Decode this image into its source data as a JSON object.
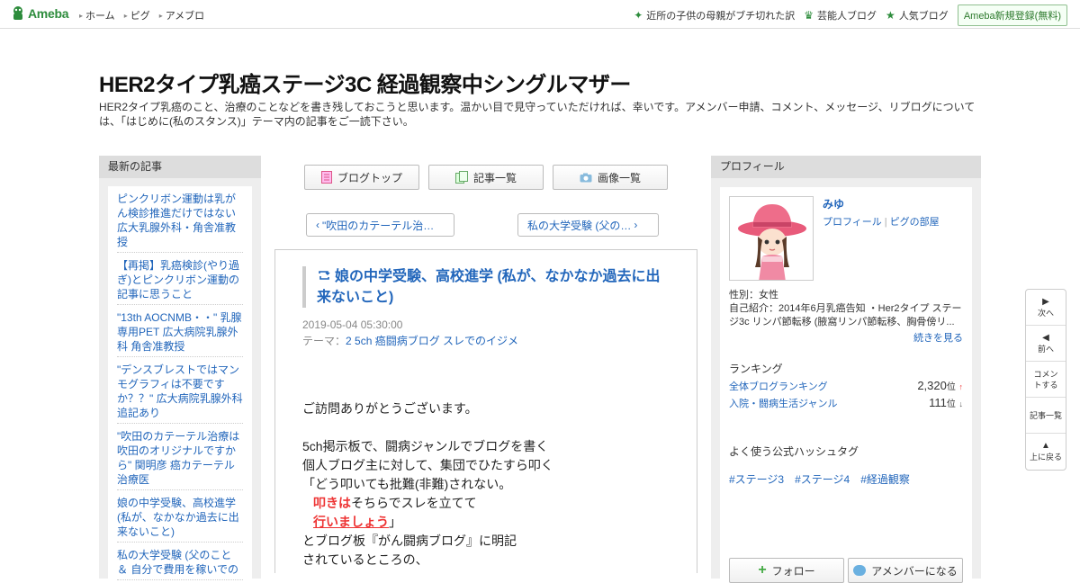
{
  "topbar": {
    "logo": "Ameba",
    "nav": [
      "ホーム",
      "ピグ",
      "アメブロ"
    ],
    "right_links": [
      {
        "icon": "sparkle-icon",
        "label": "近所の子供の母親がブチ切れた訳"
      },
      {
        "icon": "crown-icon",
        "label": "芸能人ブログ"
      },
      {
        "icon": "star-icon",
        "label": "人気ブログ"
      }
    ],
    "register": "Ameba新規登録(無料)"
  },
  "header": {
    "title": "HER2タイプ乳癌ステージ3C 経過観察中シングルマザー",
    "description": "HER2タイプ乳癌のこと、治療のことなどを書き残しておこうと思います。温かい目で見守っていただければ、幸いです。アメンバー申請、コメント、メッセージ、リブログについては、「はじめに(私のスタンス)」テーマ内の記事をご一読下さい。"
  },
  "recent": {
    "heading": "最新の記事",
    "items": [
      "ピンクリボン運動は乳がん検診推進だけではない 広大乳腺外科・角舎准教授",
      "【再掲】乳癌検診(やり過ぎ)とピンクリボン運動の記事に思うこと",
      "\"13th AOCNMB・・\" 乳腺専用PET 広大病院乳腺外科 角舎准教授",
      "\"デンスブレストではマンモグラフィは不要ですか？？\" 広大病院乳腺外科追記あり",
      "\"吹田のカテーテル治療は吹田のオリジナルですから\" 関明彦 癌カテーテル治療医",
      "娘の中学受験、高校進学 (私が、なかなか過去に出来ないこと)",
      "私の大学受験 (父のこと ＆ 自分で費用を稼いでの"
    ]
  },
  "toolbar": {
    "top": "ブログトップ",
    "list": "記事一覧",
    "images": "画像一覧"
  },
  "pager": {
    "prev": "\"吹田のカテーテル治…",
    "next": "私の大学受験 (父の…"
  },
  "article": {
    "title": "娘の中学受験、高校進学 (私が、なかなか過去に出来ないこと)",
    "date": "2019-05-04 05:30:00",
    "theme_label": "テーマ：",
    "theme": "2 5ch 癌闘病ブログ スレでのイジメ",
    "lines": {
      "l1": "ご訪問ありがとうございます。",
      "l2": "5ch掲示板で、闘病ジャンルでブログを書く",
      "l3": "個人ブログ主に対して、集団でひたすら叩く",
      "l4": "「どう叩いても批難(非難)されない。",
      "l5a": "叩きは",
      "l5b": "そちらでスレを立てて",
      "l6a": "行いましょう",
      "l6b": "」",
      "l7": "とブログ板『がん闘病ブログ』に明記",
      "l8": "されているところの、"
    }
  },
  "profile": {
    "heading": "プロフィール",
    "name": "みゆ",
    "link_profile": "プロフィール",
    "link_room": "ピグの部屋",
    "gender": "性別：女性",
    "intro": "自己紹介：2014年6月乳癌告知 ・Her2タイプ ステージ3c リンパ節転移 (腋窩リンパ節転移、胸骨傍リ...",
    "more": "続きを見る",
    "ranking_heading": "ランキング",
    "rankings": [
      {
        "label": "全体ブログランキング",
        "value": "2,320",
        "unit": "位",
        "trend": "↑"
      },
      {
        "label": "入院・闘病生活ジャンル",
        "value": "111",
        "unit": "位",
        "trend": "↓"
      }
    ],
    "tags_heading": "よく使う公式ハッシュタグ",
    "tags": [
      "#ステージ3",
      "#ステージ4",
      "#経過観察"
    ],
    "follow": "フォロー",
    "amember": "アメンバーになる"
  },
  "floatnav": {
    "next": "次へ",
    "prev": "前へ",
    "comment": "コメントする",
    "list": "記事一覧",
    "top": "上に戻る"
  },
  "colors": {
    "accent": "#2266bb",
    "brand": "#2d8c3c",
    "highlight": "#e33333"
  }
}
